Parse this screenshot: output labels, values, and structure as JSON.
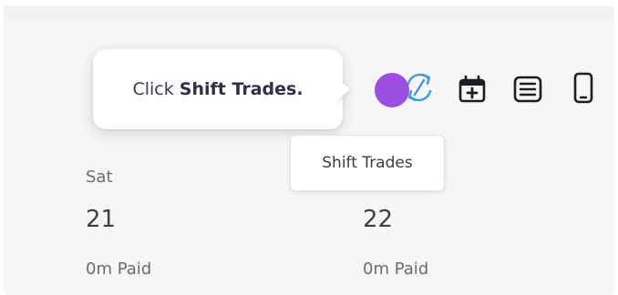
{
  "guide": {
    "prefix": "Click ",
    "emphasis": "Shift Trades."
  },
  "toolbar": {
    "tooltip": "Shift Trades",
    "icons": [
      "shift-trades-icon",
      "calendar-add-icon",
      "list-view-icon",
      "mobile-device-icon"
    ],
    "beacon_color": "#9b4ee0",
    "accent_color": "#3a9be8"
  },
  "days": [
    {
      "label": "Sat",
      "number": "21",
      "paid": "0m Paid"
    },
    {
      "label": "",
      "number": "22",
      "paid": "0m Paid"
    }
  ]
}
